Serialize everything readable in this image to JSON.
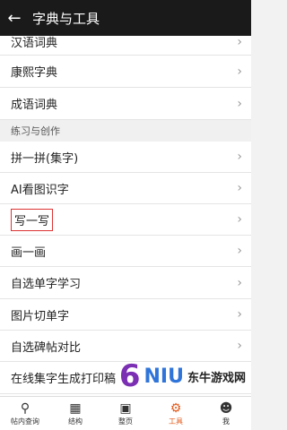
{
  "header": {
    "title": "字典与工具"
  },
  "list": {
    "items_top": [
      {
        "label": "汉语词典"
      },
      {
        "label": "康熙字典"
      },
      {
        "label": "成语词典"
      }
    ],
    "section_title": "练习与创作",
    "items_bottom": [
      {
        "label": "拼一拼(集字)"
      },
      {
        "label": "AI看图识字"
      },
      {
        "label": "写一写"
      },
      {
        "label": "画一画"
      },
      {
        "label": "自选单字学习"
      },
      {
        "label": "图片切单字"
      },
      {
        "label": "自选碑帖对比"
      },
      {
        "label": "在线集字生成打印稿"
      }
    ]
  },
  "watermark": {
    "digit": "6",
    "brand": "NIU",
    "site": "东牛游戏网"
  },
  "tabbar": {
    "items": [
      {
        "label": "帖内查询",
        "icon": "search-icon"
      },
      {
        "label": "结构",
        "icon": "structure-icon"
      },
      {
        "label": "整页",
        "icon": "page-icon"
      },
      {
        "label": "工具",
        "icon": "tools-icon",
        "active": true
      },
      {
        "label": "我",
        "icon": "user-icon"
      }
    ],
    "active_color": "#e35a1b"
  }
}
